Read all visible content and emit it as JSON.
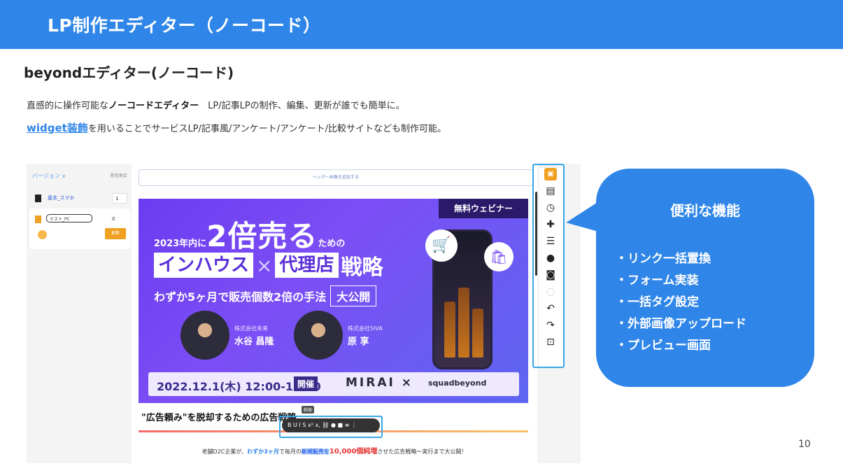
{
  "header": {
    "title": "LP制作エディター（ノーコード）",
    "color": "#2f86e8"
  },
  "subtitle": "beyondエディター(ノーコード)",
  "description": {
    "line1_prefix": "直感的に操作可能な",
    "line1_bold": "ノーコードエディター",
    "line1_suffix": "　LP/記事LPの制作、編集、更新が誰でも簡単に。",
    "line2_link": "widget装飾",
    "line2_suffix": "を用いることでサービスLP/記事風/アンケート/アンケート/比較サイトなども制作可能。"
  },
  "editor": {
    "side": {
      "version_label": "バージョン ∨",
      "ratio_label": "配信割合",
      "row1_label": "基本_スマホ",
      "row1_value": "1",
      "row2_label": "テスト_PC",
      "row2_value": "0",
      "update_button": "更新"
    },
    "header_add": "ヘッダー画像を追加する",
    "banner": {
      "badge": "無料ウェビナー",
      "line1_pre": "2023年内に",
      "line1_big": "2倍売る",
      "line1_post": "ための",
      "line2_a": "インハウス",
      "line2_x": "×",
      "line2_b": "代理店",
      "line2_c": "戦略",
      "line3": "わずか5ヶ月で販売個数2倍の手法",
      "line3_box": "大公開",
      "person1_company": "株式会社未来",
      "person1_name": "水谷 昌隆",
      "person2_company": "株式会社SIVA",
      "person2_name": "原 享",
      "date": "2022.12.1(木) 12:00-13:00",
      "kaisai": "開催",
      "mirai": "MIRAI ×",
      "squad": "squadbeyond"
    },
    "tooltip": "斜体",
    "heading": "\"広告頼み\"を脱却するための広告戦略",
    "format_bar": "B U I S x² x, ⛓ ● ■ ≡ ⋮",
    "body": {
      "pre": "老舗D2C企業が、",
      "blue": "わずか3ヶ月",
      "mid1": "で毎月の",
      "hl": "新規販売を",
      "red": "10,000個純増",
      "post": "させた広告戦略〜実行まで大公開！"
    }
  },
  "callout": {
    "title": "便利な機能",
    "items": [
      "・リンク一括置換",
      "・フォーム実装",
      "・一括タグ設定",
      "・外部画像アップロード",
      "・プレビュー画面"
    ]
  },
  "page_number": "10"
}
